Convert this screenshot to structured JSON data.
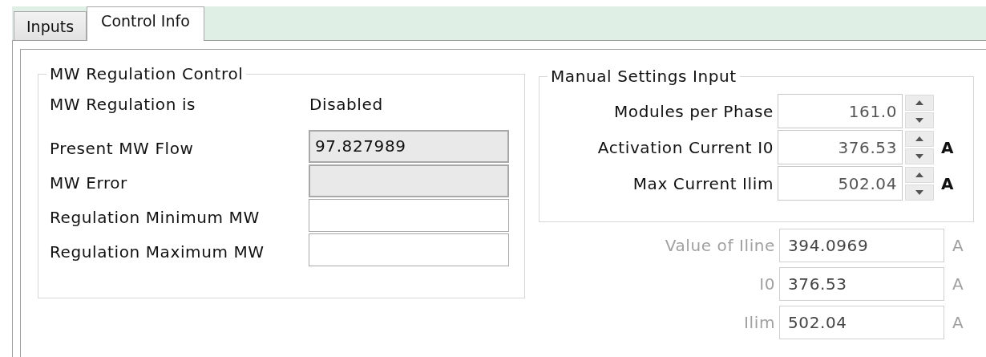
{
  "tabs": [
    {
      "label": "Inputs",
      "selected": false
    },
    {
      "label": "Control Info",
      "selected": true
    }
  ],
  "mw_regulation_control": {
    "title": "MW Regulation Control",
    "status_label": "MW Regulation is",
    "status_value": "Disabled",
    "fields": [
      {
        "label": "Present MW Flow",
        "value": "97.827989",
        "readonly": true
      },
      {
        "label": "MW Error",
        "readonly": true
      },
      {
        "label": "Regulation Minimum MW",
        "readonly": false
      },
      {
        "label": "Regulation Maximum MW",
        "readonly": false
      }
    ]
  },
  "manual_settings_input": {
    "title": "Manual Settings Input",
    "fields": [
      {
        "label": "Modules per Phase",
        "value": "161.0"
      },
      {
        "label": "Activation Current I0",
        "value": "376.53",
        "unit": "A"
      },
      {
        "label": "Max Current Ilim",
        "value": "502.04",
        "unit": "A"
      }
    ]
  },
  "computed_values": [
    {
      "label": "Value of Iline",
      "value": "394.0969",
      "unit": "A",
      "disabled": true
    },
    {
      "label": "I0",
      "value": "376.53",
      "unit": "A",
      "disabled": true
    },
    {
      "label": "Ilim",
      "value": "502.04",
      "unit": "A",
      "disabled": true
    }
  ]
}
